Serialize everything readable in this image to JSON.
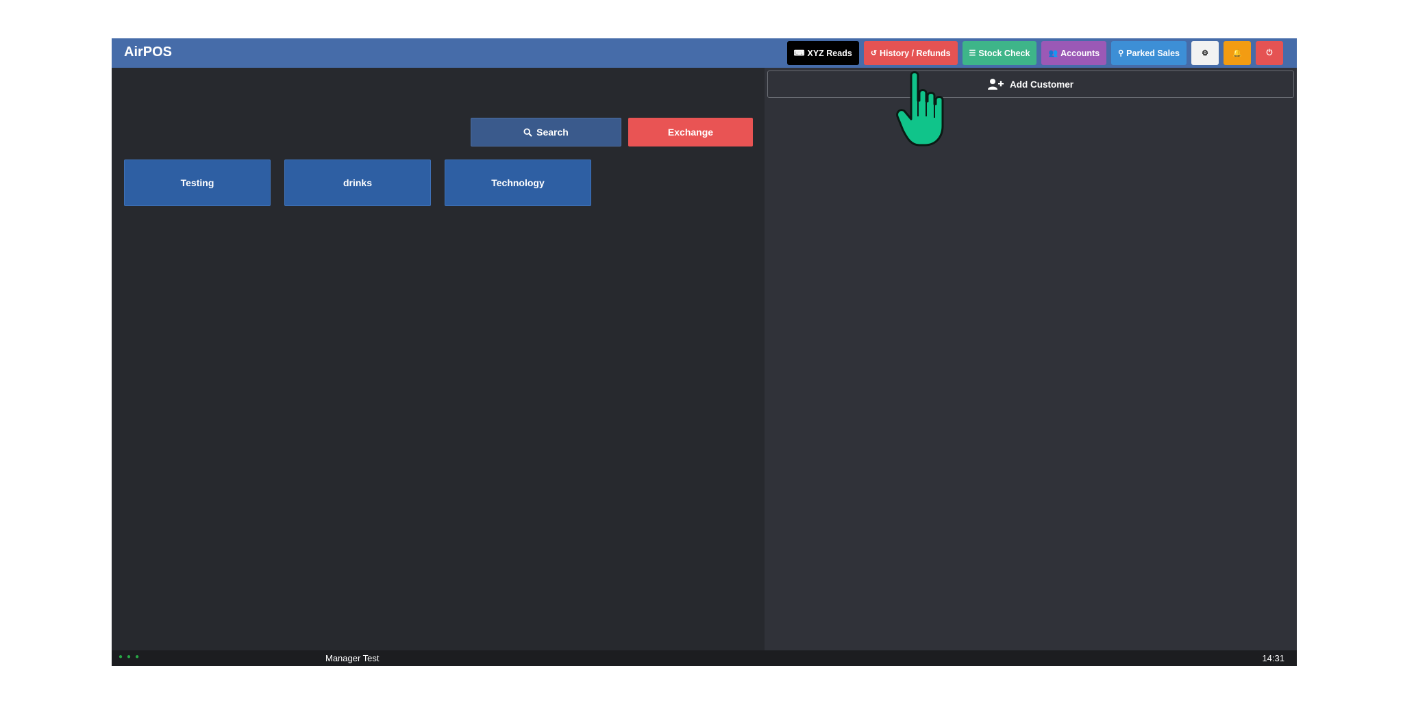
{
  "app": {
    "title": "AirPOS"
  },
  "nav": [
    {
      "label": "XYZ Reads",
      "icon": "keyboard-icon",
      "glyph": "⌨",
      "color": "#000000"
    },
    {
      "label": "History / Refunds",
      "icon": "history-icon",
      "glyph": "↺",
      "color": "#e55353"
    },
    {
      "label": "Stock Check",
      "icon": "list-icon",
      "glyph": "☰",
      "color": "#3eb589"
    },
    {
      "label": "Accounts",
      "icon": "users-icon",
      "glyph": "👥",
      "color": "#9b59b6"
    },
    {
      "label": "Parked Sales",
      "icon": "binoculars-icon",
      "glyph": "⚲",
      "color": "#3d8fd6"
    }
  ],
  "nav_icons": {
    "settings": {
      "icon": "gear-icon",
      "glyph": "⚙",
      "color": "#f2f2f2"
    },
    "alerts": {
      "icon": "bell-icon",
      "glyph": "🔔",
      "color": "#f39c12"
    },
    "power": {
      "icon": "power-icon",
      "glyph": "⏻",
      "color": "#e55353"
    }
  },
  "actions": {
    "search_label": "Search",
    "search_color": "#3a5a8c",
    "exchange_label": "Exchange",
    "exchange_color": "#e95454"
  },
  "categories": [
    "Testing",
    "drinks",
    "Technology"
  ],
  "customer": {
    "add_label": "Add Customer"
  },
  "status": {
    "operator": "Manager Test",
    "time": "14:31"
  }
}
